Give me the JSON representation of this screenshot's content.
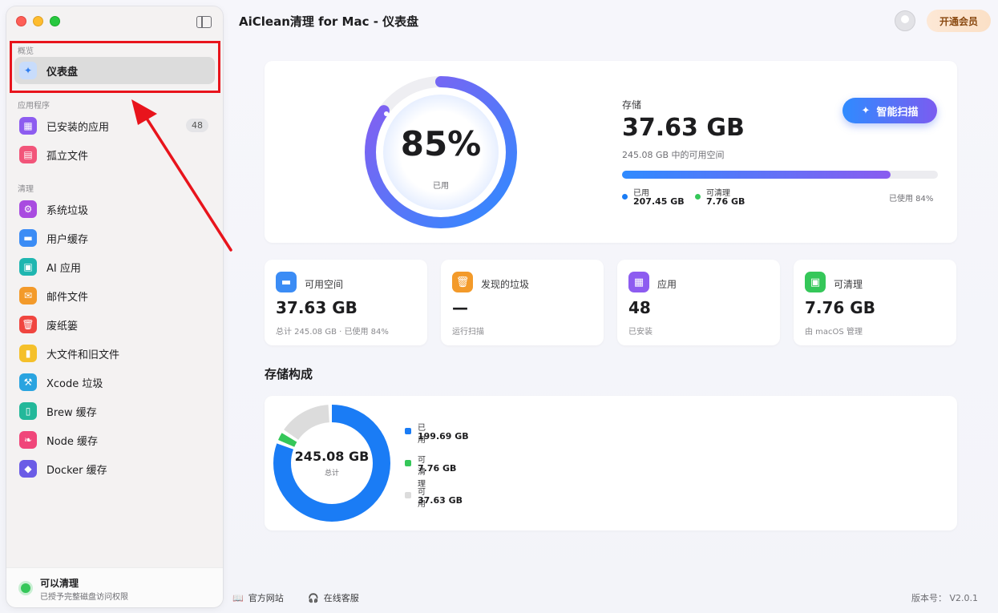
{
  "app": {
    "title": "AiClean清理 for Mac - 仪表盘",
    "member_label": "开通会员"
  },
  "sidebar": {
    "sections": [
      "概览",
      "应用程序",
      "清理"
    ],
    "overview": [
      {
        "label": "仪表盘",
        "icon": "sparkle-icon"
      }
    ],
    "apps": [
      {
        "label": "已安装的应用",
        "icon": "grid-icon",
        "badge": "48"
      },
      {
        "label": "孤立文件",
        "icon": "file-icon"
      }
    ],
    "clean": [
      {
        "label": "系统垃圾",
        "icon": "gear-icon"
      },
      {
        "label": "用户缓存",
        "icon": "drive-icon"
      },
      {
        "label": "AI 应用",
        "icon": "chip-icon"
      },
      {
        "label": "邮件文件",
        "icon": "mail-icon"
      },
      {
        "label": "废纸篓",
        "icon": "trash-icon"
      },
      {
        "label": "大文件和旧文件",
        "icon": "document-icon"
      },
      {
        "label": "Xcode 垃圾",
        "icon": "hammer-icon"
      },
      {
        "label": "Brew 缓存",
        "icon": "mug-icon"
      },
      {
        "label": "Node 缓存",
        "icon": "leaf-icon"
      },
      {
        "label": "Docker 缓存",
        "icon": "cube-icon"
      }
    ],
    "footer": {
      "title": "可以清理",
      "subtitle": "已授予完整磁盘访问权限"
    }
  },
  "overview": {
    "percent": "85%",
    "percent_label": "已用",
    "storage_label": "存储",
    "storage_value": "37.63 GB",
    "storage_sub": "245.08 GB 中的可用空间",
    "bar_fill_fraction": 0.85,
    "legend": [
      {
        "name": "已用",
        "value": "207.45 GB",
        "color": "#1a7cf5"
      },
      {
        "name": "可清理",
        "value": "7.76 GB",
        "color": "#35c759"
      }
    ],
    "used_pct_text": "已使用 84%",
    "scan_button": "智能扫描"
  },
  "stats": [
    {
      "title": "可用空间",
      "value": "37.63 GB",
      "sub": "总计 245.08 GB · 已使用 84%",
      "icon": "drive-icon",
      "color": "#3b8cf5"
    },
    {
      "title": "发现的垃圾",
      "value": "—",
      "sub": "运行扫描",
      "icon": "trash-icon",
      "color": "#f39a2a"
    },
    {
      "title": "应用",
      "value": "48",
      "sub": "已安装",
      "icon": "grid-icon",
      "color": "#8d5cf0"
    },
    {
      "title": "可清理",
      "value": "7.76 GB",
      "sub": "由 macOS 管理",
      "icon": "chip-icon",
      "color": "#35c759"
    }
  ],
  "composition": {
    "heading": "存储构成",
    "total": "245.08 GB",
    "total_label": "总计",
    "items": [
      {
        "name": "已用",
        "value": "199.69 GB",
        "color": "#1a7cf5",
        "gb": 199.69
      },
      {
        "name": "可清理",
        "value": "7.76 GB",
        "color": "#35c759",
        "gb": 7.76
      },
      {
        "name": "可用",
        "value": "37.63 GB",
        "color": "#dcdcdc",
        "gb": 37.63
      }
    ]
  },
  "footer": {
    "website": "官方网站",
    "support": "在线客服",
    "version": "版本号：  V2.0.1"
  }
}
